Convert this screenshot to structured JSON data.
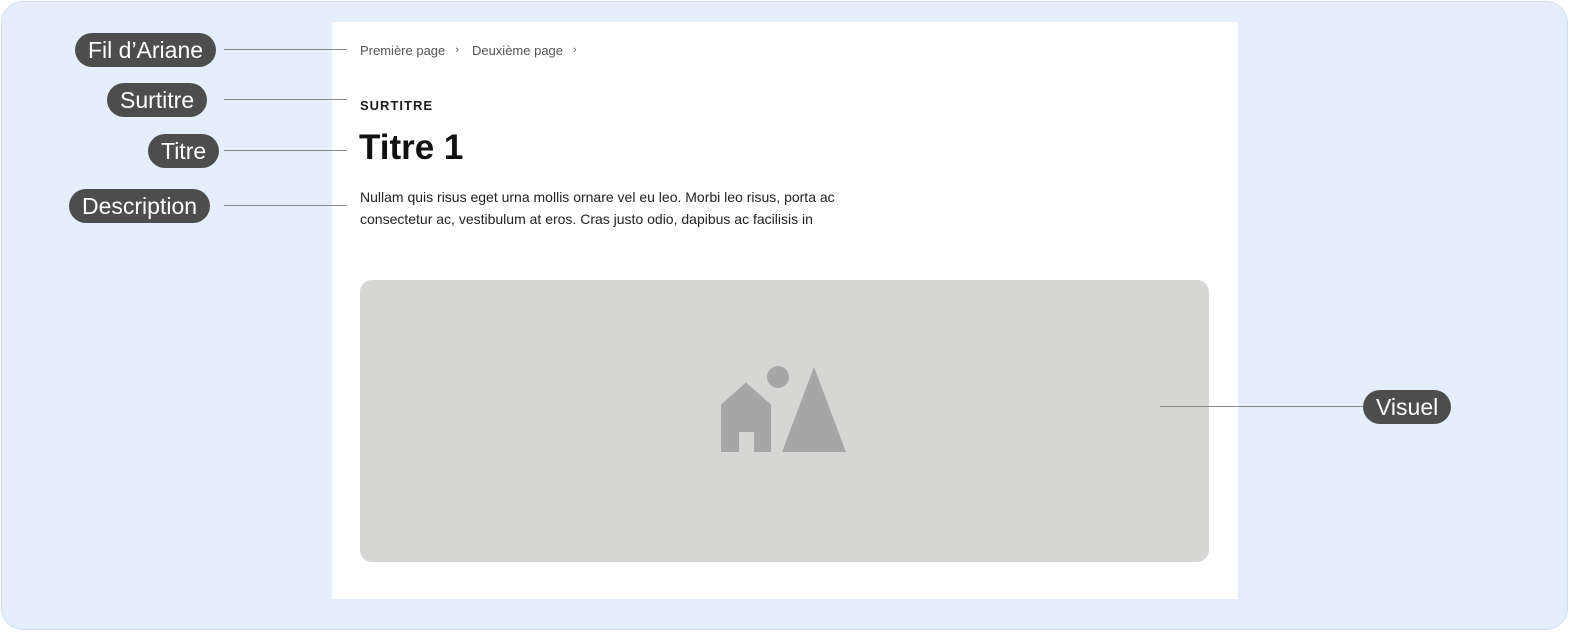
{
  "annotations": {
    "fil_ariane": "Fil d’Ariane",
    "surtitre": "Surtitre",
    "titre": "Titre",
    "description": "Description",
    "visuel": "Visuel"
  },
  "page": {
    "breadcrumb": {
      "items": [
        "Première page",
        "Deuxième page"
      ],
      "separator": "›"
    },
    "surtitre": "SURTITRE",
    "titre": "Titre 1",
    "description": "Nullam quis risus eget urna mollis ornare vel eu leo. Morbi leo risus, porta ac consectetur ac, vestibulum at eros. Cras justo odio, dapibus ac facilisis in"
  },
  "colors": {
    "background": "#e5effb",
    "card": "#ffffff",
    "tag": "#4d4d4d",
    "placeholder": "#d6d6d5",
    "placeholder_icon": "#a6a6a6"
  },
  "icons": {
    "visual_placeholder": "image-placeholder-icon"
  }
}
